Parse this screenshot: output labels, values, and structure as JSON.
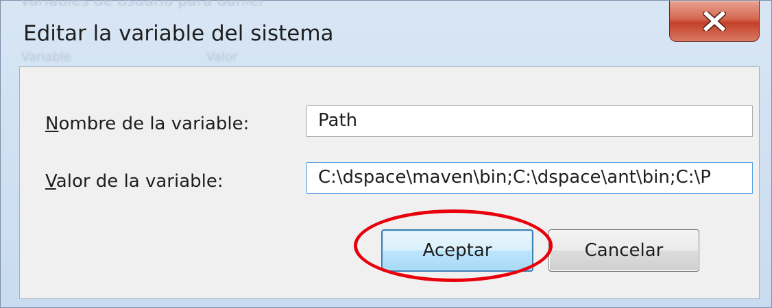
{
  "background_window": {
    "ghost_title": "Variables de usuario para daniel",
    "ghost_col1": "Variable",
    "ghost_col2": "Valor"
  },
  "dialog": {
    "title": "Editar la variable del sistema",
    "close_icon": "close-x-icon"
  },
  "form": {
    "name_label_mnemonic": "N",
    "name_label_rest": "ombre de la variable:",
    "name_value": "Path",
    "value_label_mnemonic": "V",
    "value_label_rest": "alor de la variable:",
    "value_value": "C:\\dspace\\maven\\bin;C:\\dspace\\ant\\bin;C:\\P"
  },
  "buttons": {
    "ok_label": "Aceptar",
    "cancel_label": "Cancelar"
  },
  "colors": {
    "highlight": "#e8000b",
    "close_button": "#c4402a"
  }
}
